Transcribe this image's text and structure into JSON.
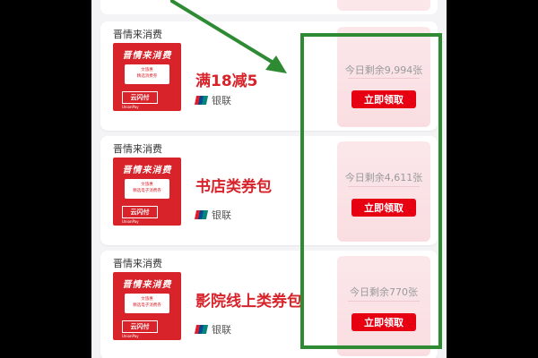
{
  "colors": {
    "accent": "#d8232a",
    "button": "#e60012",
    "highlight": "#2e8b34"
  },
  "coupons": [
    {
      "merchant": "晋情来消费",
      "thumb_brand": "晋情来消费",
      "thumb_ticket_line1": "文旅惠",
      "thumb_ticket_line2": "精选消费券",
      "thumb_pay": "云闪付",
      "thumb_pay_sub": "UnionPay",
      "title": "满18减5",
      "bank": "银联",
      "remaining": "今日剩余9,994张",
      "claim": "立即领取"
    },
    {
      "merchant": "晋情来消费",
      "thumb_brand": "晋情来消费",
      "thumb_ticket_line1": "文旅惠",
      "thumb_ticket_line2": "精选电子消费券",
      "thumb_pay": "云闪付",
      "thumb_pay_sub": "UnionPay",
      "title": "书店类券包",
      "bank": "银联",
      "remaining": "今日剩余4,611张",
      "claim": "立即领取"
    },
    {
      "merchant": "晋情来消费",
      "thumb_brand": "晋情来消费",
      "thumb_ticket_line1": "文旅惠",
      "thumb_ticket_line2": "精选电子消费券",
      "thumb_pay": "云闪付",
      "thumb_pay_sub": "UnionPay",
      "title": "影院线上类券包",
      "bank": "银联",
      "remaining": "今日剩余770张",
      "claim": "立即领取"
    }
  ]
}
